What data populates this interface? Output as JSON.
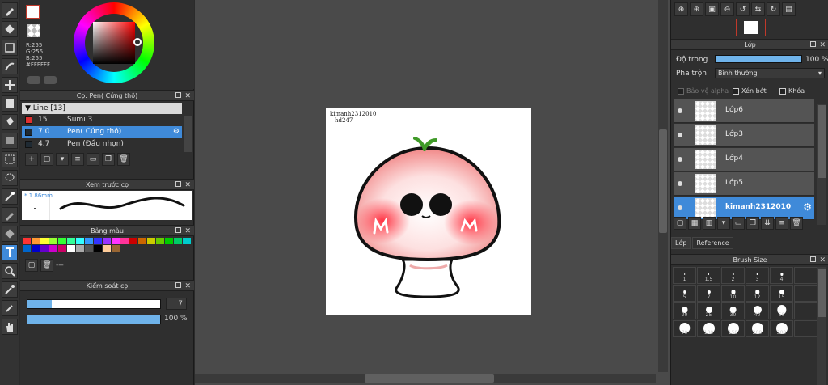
{
  "color": {
    "fg": "#FFFFFF",
    "rgb_lines": [
      "R:255",
      "G:255",
      "B:255",
      "#FFFFFF"
    ]
  },
  "brush_panel": {
    "title": "Cọ: Pen( Cứng thô)",
    "group": "Line [13]",
    "rows": [
      {
        "color": "#e03030",
        "size": "15",
        "name": "Sumi 3",
        "selected": false
      },
      {
        "color": "#1f2a33",
        "size": "7.0",
        "name": "Pen( Cứng thô)",
        "selected": true
      },
      {
        "color": "#1f2a33",
        "size": "4.7",
        "name": "Pen (Đầu nhọn)",
        "selected": false
      }
    ]
  },
  "preview": {
    "title": "Xem trước cọ",
    "size_label": "* 1.86mm"
  },
  "palette": {
    "title": "Bảng màu",
    "colors": [
      "#ff3333",
      "#ff9933",
      "#ffff33",
      "#99ff33",
      "#33ff33",
      "#33ff99",
      "#33ffff",
      "#3399ff",
      "#3333ff",
      "#9933ff",
      "#ff33ff",
      "#ff3399",
      "#cc0000",
      "#cc6600",
      "#cccc00",
      "#66cc00",
      "#00cc00",
      "#00cc66",
      "#00cccc",
      "#0066cc",
      "#0000cc",
      "#6600cc",
      "#cc00cc",
      "#cc0066",
      "#ffffff",
      "#aaaaaa",
      "#555555",
      "#000000",
      "#ffcc99",
      "#996633"
    ],
    "footer_label": "---"
  },
  "control": {
    "title": "Kiểm soát cọ",
    "size_value": "7",
    "size_fraction": 0.18,
    "opacity_value": "100 %",
    "opacity_fraction": 1.0
  },
  "canvas": {
    "credit_line1": "kimanh2312010",
    "credit_line2": "hd247"
  },
  "layer_panel": {
    "title": "Lớp",
    "opacity_label": "Độ trong",
    "opacity_value": "100 %",
    "blend_label": "Pha trộn",
    "blend_value": "Bình thường",
    "protect_alpha": "Bảo vệ alpha",
    "clipping": "Xén bớt",
    "lock": "Khóa",
    "layers": [
      {
        "name": "Lớp6",
        "selected": false
      },
      {
        "name": "Lớp3",
        "selected": false
      },
      {
        "name": "Lớp4",
        "selected": false
      },
      {
        "name": "Lớp5",
        "selected": false
      },
      {
        "name": "kimanh2312010",
        "selected": true
      }
    ],
    "tabs": [
      "Lớp",
      "Reference"
    ]
  },
  "brush_size": {
    "title": "Brush Size",
    "sizes": [
      "1",
      "1.5",
      "2",
      "3",
      "4",
      "5",
      "7",
      "10",
      "12",
      "15",
      "20",
      "25",
      "30",
      "40",
      "50",
      "70",
      "100",
      "150",
      "200",
      "300"
    ]
  }
}
